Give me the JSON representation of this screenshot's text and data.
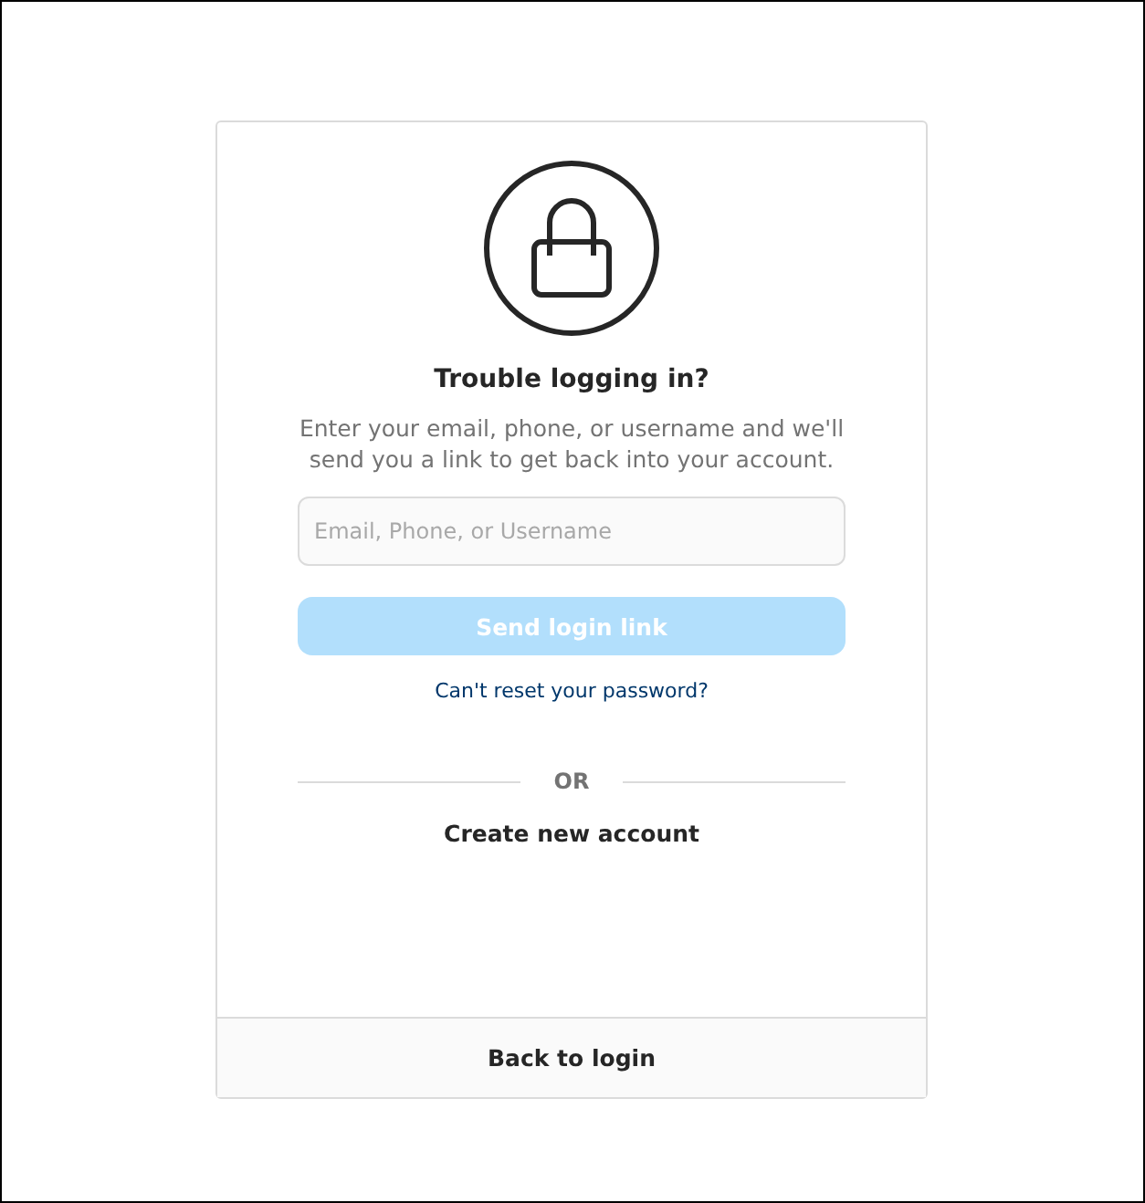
{
  "title": "Trouble logging in?",
  "description": "Enter your email, phone, or username and we'll send you a link to get back into your account.",
  "input": {
    "placeholder": "Email, Phone, or Username"
  },
  "send_button": {
    "label": "Send login link",
    "disabled": true
  },
  "reset_link": "Can't reset your password?",
  "divider": "OR",
  "create_account": "Create new account",
  "back_to_login": "Back to login"
}
